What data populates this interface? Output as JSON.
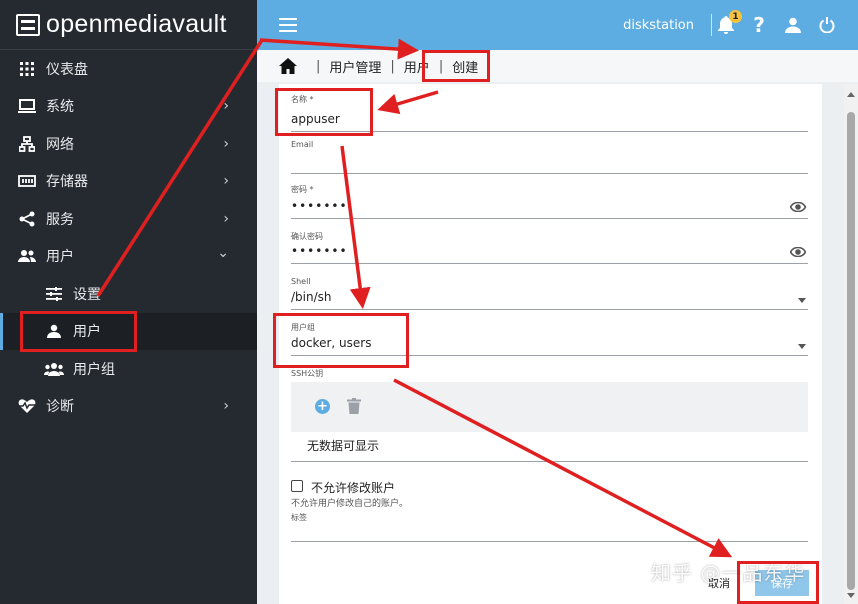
{
  "brand": {
    "name": "openmediavault"
  },
  "sidebar": {
    "items": [
      {
        "label": "仪表盘",
        "icon": "dashboard-grid-icon",
        "has_chevron": false
      },
      {
        "label": "系统",
        "icon": "laptop-icon",
        "has_chevron": true,
        "chevron": "›"
      },
      {
        "label": "网络",
        "icon": "network-icon",
        "has_chevron": true,
        "chevron": "›"
      },
      {
        "label": "存储器",
        "icon": "storage-icon",
        "has_chevron": true,
        "chevron": "›"
      },
      {
        "label": "服务",
        "icon": "share-icon",
        "has_chevron": true,
        "chevron": "›"
      },
      {
        "label": "用户",
        "icon": "users-icon",
        "has_chevron": true,
        "chevron": "⌄",
        "expanded": true
      },
      {
        "label": "设置",
        "icon": "sliders-icon",
        "sub": true
      },
      {
        "label": "用户",
        "icon": "user-icon",
        "sub": true,
        "active": true
      },
      {
        "label": "用户组",
        "icon": "group-icon",
        "sub": true
      },
      {
        "label": "诊断",
        "icon": "heartbeat-icon",
        "has_chevron": true,
        "chevron": "›"
      }
    ]
  },
  "topbar": {
    "hostname": "diskstation",
    "notification_count": "1",
    "icons": [
      "menu-icon",
      "bell-icon",
      "help-icon",
      "account-icon",
      "power-icon"
    ]
  },
  "breadcrumb": {
    "items": [
      "用户管理",
      "用户",
      "创建"
    ],
    "separator": "|"
  },
  "form": {
    "name_label": "名称 *",
    "name_value": "appuser",
    "email_label": "Email",
    "email_value": "",
    "password_label": "密码 *",
    "password_value": "•••••••",
    "confirm_label": "确认密码",
    "confirm_value": "•••••••",
    "shell_label": "Shell",
    "shell_value": "/bin/sh",
    "groups_label": "用户组",
    "groups_value": "docker, users",
    "ssh_label": "SSH公钥",
    "ssh_empty": "无数据可显示",
    "disallow_label": "不允许修改账户",
    "disallow_hint": "不允许用户修改自己的账户。",
    "disallow_checked": false,
    "tags_label": "标签",
    "tags_value": "",
    "cancel_label": "取消",
    "save_label": "保存"
  },
  "watermark": {
    "text": "知乎 @一品东华"
  },
  "colors": {
    "topbar": "#5dade2",
    "sidebar": "#252a30",
    "annotation": "#e02020",
    "save_button": "#8fc6ea"
  }
}
